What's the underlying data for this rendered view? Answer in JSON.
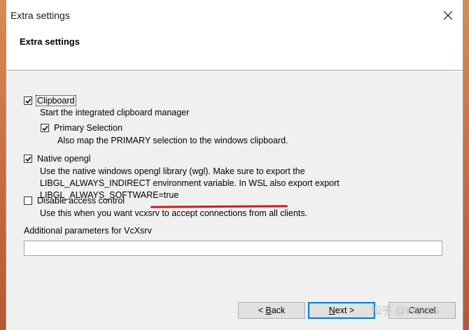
{
  "window": {
    "title": "Extra settings"
  },
  "header": {
    "title": "Extra settings"
  },
  "options": {
    "clipboard": {
      "label": "Clipboard",
      "checked": true,
      "description": "Start the integrated clipboard manager"
    },
    "primary_selection": {
      "label": "Primary Selection",
      "checked": true,
      "description": "Also map the PRIMARY selection to the windows clipboard."
    },
    "native_opengl": {
      "label": "Native opengl",
      "checked": true,
      "description_lines": [
        "Use the native windows opengl library (wgl). Make sure to export the",
        "LIBGL_ALWAYS_INDIRECT environment variable. In WSL also export export",
        "LIBGL_ALWAYS_SOFTWARE=true"
      ]
    },
    "disable_access_control": {
      "label": "Disable access control",
      "checked": false,
      "description": "Use this when you want vcxsrv to accept connections from all clients."
    }
  },
  "additional_params": {
    "label": "Additional parameters for VcXsrv",
    "value": ""
  },
  "buttons": {
    "back": {
      "prefix": "< ",
      "mnemonic": "B",
      "rest": "ack"
    },
    "next": {
      "mnemonic": "N",
      "rest": "ext >"
    },
    "cancel": {
      "label": "Cancel"
    }
  },
  "watermark": {
    "text": "知乎 @WSWS"
  },
  "colors": {
    "annotation_red": "#d11a1a",
    "default_button_border": "#0078d7"
  }
}
